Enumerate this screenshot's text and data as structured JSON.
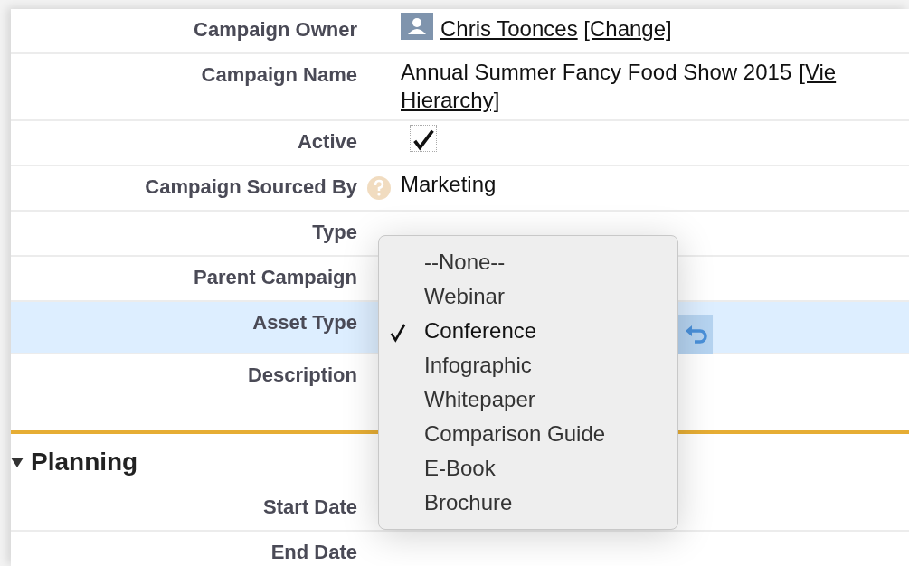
{
  "fields": [
    {
      "label": "Campaign Owner",
      "kind": "owner",
      "value": "Chris Toonces",
      "link": "[Change]"
    },
    {
      "label": "Campaign Name",
      "kind": "name",
      "value": "Annual Summer Fancy Food Show 2015",
      "link": "[Vie",
      "link_line2": "Hierarchy]"
    },
    {
      "label": "Active",
      "kind": "checkbox",
      "checked": true
    },
    {
      "label": "Campaign Sourced By",
      "kind": "text",
      "help": true,
      "value": "Marketing"
    },
    {
      "label": "Type",
      "kind": "empty"
    },
    {
      "label": "Parent Campaign",
      "kind": "empty"
    },
    {
      "label": "Asset Type",
      "kind": "editing",
      "highlighted": true
    },
    {
      "label": "Description",
      "kind": "tall"
    }
  ],
  "planning": {
    "title": "Planning",
    "expanded": true,
    "fields": [
      {
        "label": "Start Date"
      },
      {
        "label": "End Date"
      }
    ]
  },
  "dropdown": {
    "options": [
      {
        "label": "--None--",
        "selected": false
      },
      {
        "label": "Webinar",
        "selected": false
      },
      {
        "label": "Conference",
        "selected": true
      },
      {
        "label": "Infographic",
        "selected": false
      },
      {
        "label": "Whitepaper",
        "selected": false
      },
      {
        "label": "Comparison Guide",
        "selected": false
      },
      {
        "label": "E-Book",
        "selected": false
      },
      {
        "label": "Brochure",
        "selected": false
      }
    ]
  }
}
